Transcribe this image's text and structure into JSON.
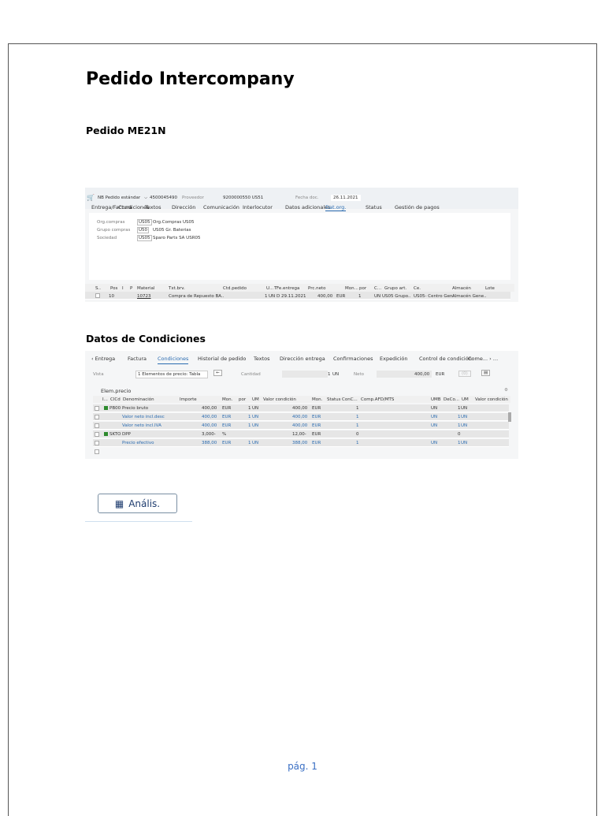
{
  "title": "Pedido Intercompany",
  "section1": "Pedido ME21N",
  "section2": "Datos de Condiciones",
  "me21n": {
    "doc_type": "NB Pedido estándar",
    "doc_number": "4500045490",
    "vendor_label": "Proveedor",
    "vendor": "9200000550 US51",
    "date_label": "Fecha doc.",
    "date": "26.11.2021",
    "tabs": [
      "Entrega/Factura",
      "Condiciones",
      "Textos",
      "Dirección",
      "Comunicación",
      "Interlocutor",
      "Datos adicionales",
      "Dat.org.",
      "Status",
      "Gestión de pagos"
    ],
    "fields": [
      {
        "label": "Org.compras",
        "code": "US05",
        "desc": "Org.Compras US05"
      },
      {
        "label": "Grupo compras",
        "code": "U50",
        "desc": "US05 Gr. Baterias"
      },
      {
        "label": "Sociedad",
        "code": "US05",
        "desc": "Sparo Parts SA USR05"
      }
    ],
    "columns": [
      "S..",
      "Pos",
      "I",
      "P",
      "Material",
      "Txt.brv.",
      "Ctd.pedido",
      "U...",
      "T",
      "Fe.entrega",
      "Prc.neto",
      "Mon...",
      "por",
      "C...",
      "Grupo art.",
      "Ce.",
      "Almacén",
      "Lote"
    ],
    "item": {
      "pos": "10",
      "material": "10723",
      "text": "Compra de Repuesto BA..",
      "qty": "1",
      "unit": "UN",
      "t": "D",
      "date": "29.11.2021",
      "price": "400,00",
      "cur": "EUR",
      "per": "1",
      "c": "UN",
      "group": "US05 Grupo..",
      "plant": "US05- Centro Gen..",
      "storage": "Almacén Gene.."
    }
  },
  "cond": {
    "tabs": [
      "Entrega",
      "Factura",
      "Condiciones",
      "Historial de pedido",
      "Textos",
      "Dirección entrega",
      "Confirmaciones",
      "Expedición",
      "Control de condición",
      "Come..."
    ],
    "vista_label": "Vista",
    "vista": "1 Elementos de precio: Tabla",
    "cantidad_label": "Cantidad",
    "cantidad": "1",
    "cantidad_unit": "UN",
    "neto_label": "Neto",
    "neto": "400,00",
    "neto_cur": "EUR",
    "calc_btn": "(0)",
    "group_label": "Elem.precio",
    "columns": [
      "I...",
      "ClCd",
      "Denominación",
      "Importe",
      "Mon.",
      "por",
      "UM",
      "Valor condición",
      "Mon.",
      "Status",
      "ConC...",
      "Comp.AFD/MTS",
      "UMB",
      "DeCo...",
      "UM",
      "Valor condición"
    ],
    "rows": [
      {
        "cl": "PB00",
        "name": "Precio bruto",
        "imp": "400,00",
        "mon": "EUR",
        "por": "1",
        "um": "UN",
        "val": "400,00",
        "mon2": "EUR",
        "conc": "1",
        "umb": "UN",
        "deco": "1",
        "um2": "UN",
        "blue": false,
        "green": true
      },
      {
        "cl": "",
        "name": "Valor neto incl.desc",
        "imp": "400,00",
        "mon": "EUR",
        "por": "1",
        "um": "UN",
        "val": "400,00",
        "mon2": "EUR",
        "conc": "1",
        "umb": "UN",
        "deco": "1",
        "um2": "UN",
        "blue": true,
        "green": false
      },
      {
        "cl": "",
        "name": "Valor neto incl.IVA",
        "imp": "400,00",
        "mon": "EUR",
        "por": "1",
        "um": "UN",
        "val": "400,00",
        "mon2": "EUR",
        "conc": "1",
        "umb": "UN",
        "deco": "1",
        "um2": "UN",
        "blue": true,
        "green": false
      },
      {
        "cl": "SKTO",
        "name": "DPP",
        "imp": "3,000-",
        "mon": "%",
        "por": "",
        "um": "",
        "val": "12,00-",
        "mon2": "EUR",
        "conc": "0",
        "umb": "",
        "deco": "0",
        "um2": "",
        "blue": false,
        "green": true
      },
      {
        "cl": "",
        "name": "Precio efectivo",
        "imp": "388,00",
        "mon": "EUR",
        "por": "1",
        "um": "UN",
        "val": "388,00",
        "mon2": "EUR",
        "conc": "1",
        "umb": "UN",
        "deco": "1",
        "um2": "UN",
        "blue": true,
        "green": false
      }
    ]
  },
  "analysis_button": "Anális.",
  "footer": "pág. 1"
}
